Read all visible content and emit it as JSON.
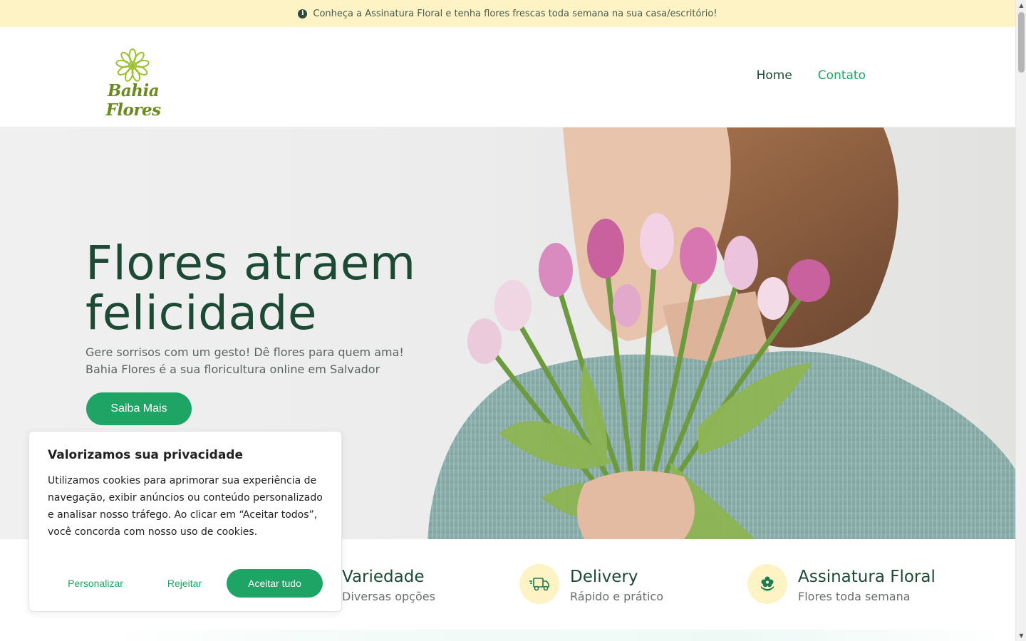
{
  "announcement": {
    "icon": "info-circle-icon",
    "text": "Conheça a Assinatura Floral e tenha flores frescas toda semana na sua casa/escritório!"
  },
  "header": {
    "logo_text": "Bahia Flores",
    "logo_color": "#6b8a1e",
    "nav": [
      {
        "label": "Home"
      },
      {
        "label": "Contato"
      }
    ]
  },
  "hero": {
    "title_line1": "Flores atraem",
    "title_line2": "felicidade",
    "subtitle_line1": "Gere sorrisos com um gesto! Dê flores para quem ama!",
    "subtitle_line2": "Bahia Flores é a sua floricultura online em Salvador",
    "cta_label": "Saiba Mais",
    "image_alt": "woman-holding-tulips-photo"
  },
  "features": [
    {
      "title": "Variedade",
      "subtitle": "Diversas opções"
    },
    {
      "title": "Delivery",
      "subtitle": "Rápido e prático",
      "icon": "delivery-truck-icon"
    },
    {
      "title": "Assinatura Floral",
      "subtitle": "Flores toda semana",
      "icon": "flower-badge-icon"
    }
  ],
  "cookie_banner": {
    "title": "Valorizamos sua privacidade",
    "body": "Utilizamos cookies para aprimorar sua experiência de navegação, exibir anúncios ou conteúdo personalizado e analisar nosso tráfego. Ao clicar em “Aceitar todos”, você concorda com nosso uso de cookies.",
    "customize_label": "Personalizar",
    "reject_label": "Rejeitar",
    "accept_label": "Aceitar tudo"
  },
  "colors": {
    "primary_green": "#1ea465",
    "dark_green": "#1d4a34",
    "banner_yellow": "#fdf3c4"
  }
}
